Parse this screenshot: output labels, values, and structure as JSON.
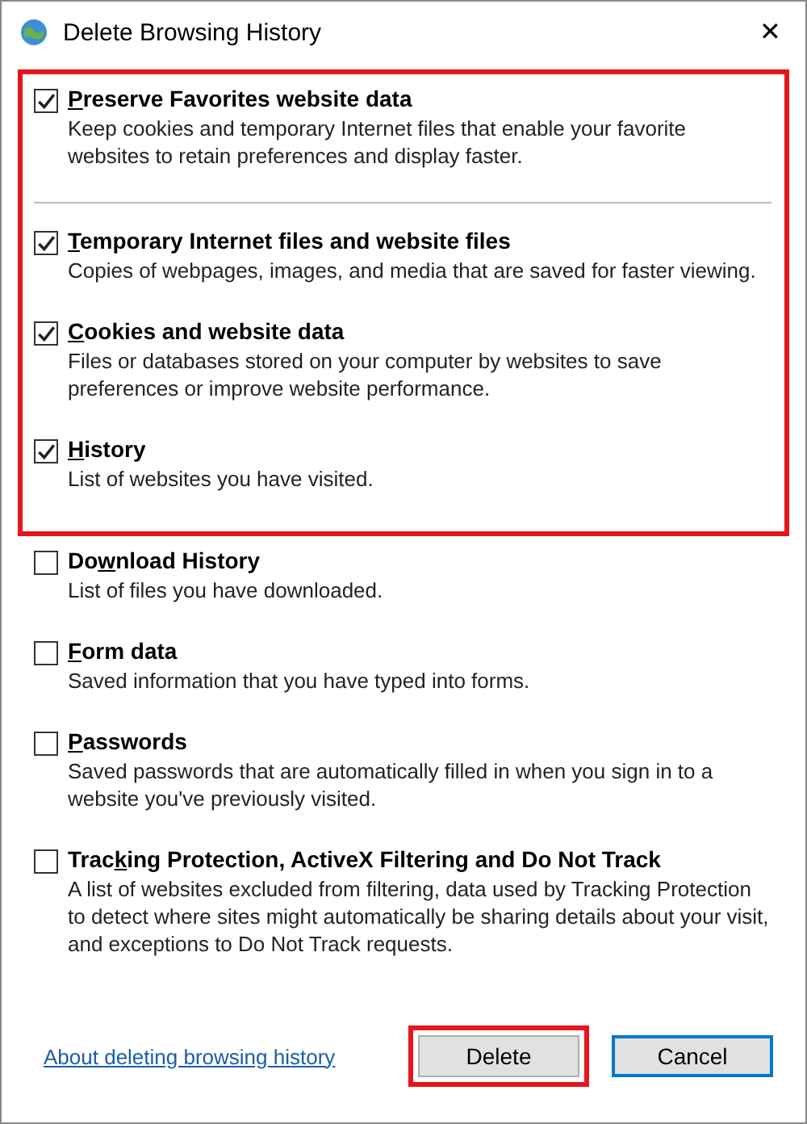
{
  "window": {
    "title": "Delete Browsing History",
    "close": "✕"
  },
  "options": [
    {
      "key": "P",
      "post": "reserve Favorites website data",
      "description": "Keep cookies and temporary Internet files that enable your favorite websites to retain preferences and display faster.",
      "checked": true,
      "highlighted": true,
      "kind": "option"
    },
    {
      "kind": "separator",
      "highlighted": true
    },
    {
      "key": "T",
      "post": "emporary Internet files and website files",
      "description": "Copies of webpages, images, and media that are saved for faster viewing.",
      "checked": true,
      "highlighted": true,
      "kind": "option"
    },
    {
      "key": "C",
      "post": "ookies and website data",
      "description": "Files or databases stored on your computer by websites to save preferences or improve website performance.",
      "checked": true,
      "highlighted": true,
      "kind": "option"
    },
    {
      "key": "H",
      "post": "istory",
      "description": "List of websites you have visited.",
      "checked": true,
      "highlighted": true,
      "kind": "option"
    },
    {
      "pre": "Do",
      "key": "w",
      "post": "nload History",
      "description": "List of files you have downloaded.",
      "checked": false,
      "highlighted": false,
      "kind": "option"
    },
    {
      "key": "F",
      "post": "orm data",
      "description": "Saved information that you have typed into forms.",
      "checked": false,
      "highlighted": false,
      "kind": "option"
    },
    {
      "key": "P",
      "post": "asswords",
      "description": "Saved passwords that are automatically filled in when you sign in to a website you've previously visited.",
      "checked": false,
      "highlighted": false,
      "kind": "option"
    },
    {
      "pre": "Trac",
      "key": "k",
      "post": "ing Protection, ActiveX Filtering and Do Not Track",
      "description": "A list of websites excluded from filtering, data used by Tracking Protection to detect where sites might automatically be sharing details about your visit, and exceptions to Do Not Track requests.",
      "checked": false,
      "highlighted": false,
      "kind": "option"
    }
  ],
  "footer": {
    "link": "About deleting browsing history",
    "buttons": [
      {
        "label": "Delete",
        "highlighted": true,
        "default": false
      },
      {
        "label": "Cancel",
        "highlighted": false,
        "default": true
      }
    ]
  }
}
